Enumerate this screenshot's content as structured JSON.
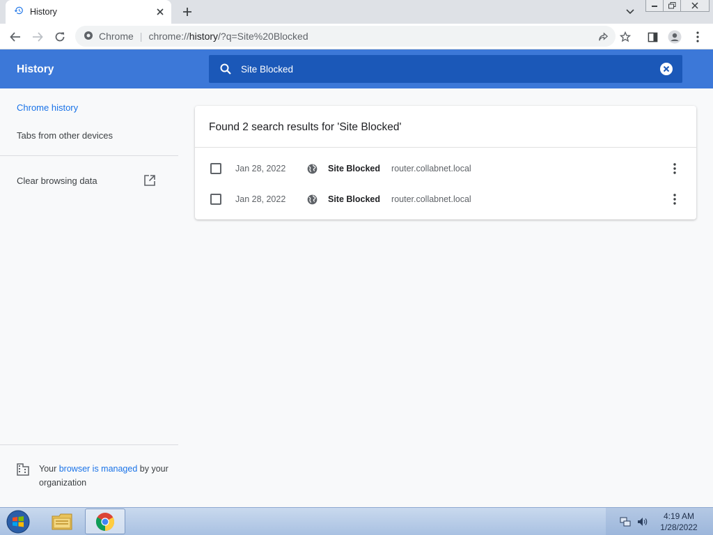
{
  "browser": {
    "tab_title": "History",
    "omnibox_origin": "Chrome",
    "url_prefix": "chrome://",
    "url_host": "history",
    "url_path": "/?q=Site%20Blocked"
  },
  "history": {
    "title": "History",
    "search_value": "Site Blocked",
    "sidebar": {
      "chrome_history": "Chrome history",
      "tabs_other_devices": "Tabs from other devices",
      "clear_browsing_data": "Clear browsing data"
    },
    "managed": {
      "pre": "Your ",
      "link": "browser is managed",
      "post": " by your organization"
    },
    "results_heading": "Found 2 search results for 'Site Blocked'",
    "results": [
      {
        "date": "Jan 28, 2022",
        "title": "Site Blocked",
        "domain": "router.collabnet.local"
      },
      {
        "date": "Jan 28, 2022",
        "title": "Site Blocked",
        "domain": "router.collabnet.local"
      }
    ]
  },
  "taskbar": {
    "time": "4:19 AM",
    "date": "1/28/2022"
  },
  "colors": {
    "header_blue": "#3c78d8",
    "search_blue": "#1b58b8",
    "link_blue": "#1a73e8"
  }
}
